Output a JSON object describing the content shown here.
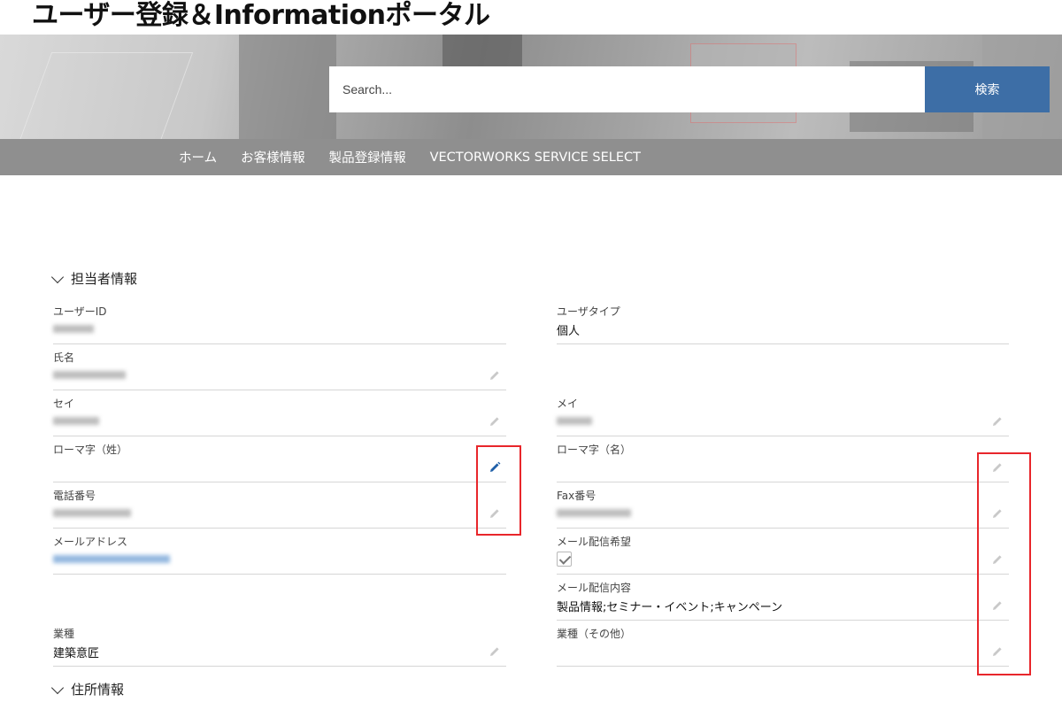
{
  "site": {
    "title": "ユーザー登録＆Informationポータル"
  },
  "search": {
    "placeholder": "Search...",
    "button_label": "検索"
  },
  "nav": {
    "items": [
      "ホーム",
      "お客様情報",
      "製品登録情報",
      "VECTORWORKS SERVICE SELECT"
    ]
  },
  "sections": {
    "contact": "担当者情報",
    "address": "住所情報"
  },
  "fields": {
    "user_id": {
      "label": "ユーザーID"
    },
    "user_type": {
      "label": "ユーザタイプ",
      "value": "個人"
    },
    "full_name": {
      "label": "氏名"
    },
    "sei": {
      "label": "セイ"
    },
    "mei": {
      "label": "メイ"
    },
    "romaji_last": {
      "label": "ローマ字（姓）"
    },
    "romaji_first": {
      "label": "ローマ字（名）"
    },
    "phone": {
      "label": "電話番号"
    },
    "fax": {
      "label": "Fax番号"
    },
    "email": {
      "label": "メールアドレス"
    },
    "mail_opt_in": {
      "label": "メール配信希望",
      "checked": true
    },
    "mail_content": {
      "label": "メール配信内容",
      "value": "製品情報;セミナー・イベント;キャンペーン"
    },
    "industry": {
      "label": "業種",
      "value": "建築意匠"
    },
    "industry_other": {
      "label": "業種（その他）"
    }
  },
  "colors": {
    "accent": "#3d6ea6",
    "highlight": "#e8262b",
    "nav_bg": "#8f8f8f",
    "edit_active": "#1f5fa8",
    "edit_inactive": "#c9c9c9"
  },
  "icons": {
    "edit": "pencil-icon",
    "section_toggle": "chevron-down-icon",
    "checkbox": "checkmark-icon"
  }
}
